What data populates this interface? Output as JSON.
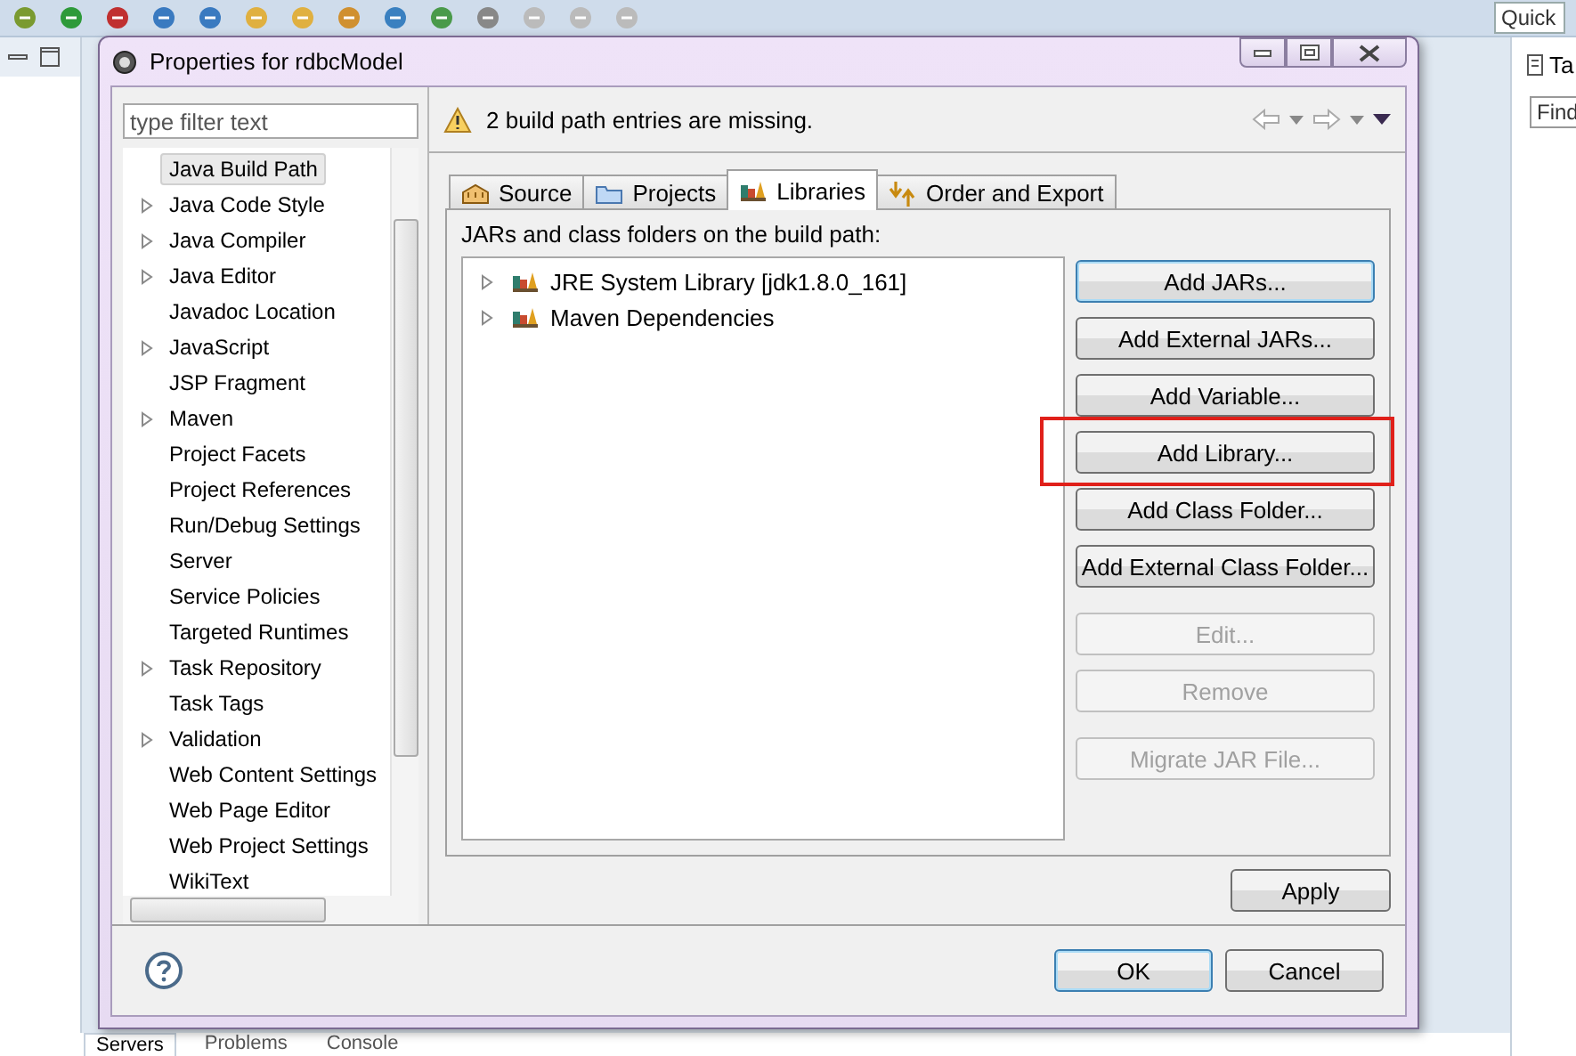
{
  "ide": {
    "quick_access": {
      "placeholder": "Quick"
    },
    "right_panel": {
      "tab": "Ta",
      "find": {
        "placeholder": "Find"
      }
    },
    "bottom_tabs": [
      {
        "label": "Servers",
        "selected": true
      },
      {
        "label": "Problems",
        "selected": false
      },
      {
        "label": "Console",
        "selected": false
      }
    ]
  },
  "window": {
    "title": "Properties for rdbcModel"
  },
  "filter": {
    "placeholder": "type filter text"
  },
  "nav": [
    {
      "label": "Java Build Path",
      "expandable": false,
      "selected": true
    },
    {
      "label": "Java Code Style",
      "expandable": true,
      "selected": false
    },
    {
      "label": "Java Compiler",
      "expandable": true,
      "selected": false
    },
    {
      "label": "Java Editor",
      "expandable": true,
      "selected": false
    },
    {
      "label": "Javadoc Location",
      "expandable": false,
      "selected": false
    },
    {
      "label": "JavaScript",
      "expandable": true,
      "selected": false
    },
    {
      "label": "JSP Fragment",
      "expandable": false,
      "selected": false
    },
    {
      "label": "Maven",
      "expandable": true,
      "selected": false
    },
    {
      "label": "Project Facets",
      "expandable": false,
      "selected": false
    },
    {
      "label": "Project References",
      "expandable": false,
      "selected": false
    },
    {
      "label": "Run/Debug Settings",
      "expandable": false,
      "selected": false
    },
    {
      "label": "Server",
      "expandable": false,
      "selected": false
    },
    {
      "label": "Service Policies",
      "expandable": false,
      "selected": false
    },
    {
      "label": "Targeted Runtimes",
      "expandable": false,
      "selected": false
    },
    {
      "label": "Task Repository",
      "expandable": true,
      "selected": false
    },
    {
      "label": "Task Tags",
      "expandable": false,
      "selected": false
    },
    {
      "label": "Validation",
      "expandable": true,
      "selected": false
    },
    {
      "label": "Web Content Settings",
      "expandable": false,
      "selected": false
    },
    {
      "label": "Web Page Editor",
      "expandable": false,
      "selected": false
    },
    {
      "label": "Web Project Settings",
      "expandable": false,
      "selected": false
    },
    {
      "label": "WikiText",
      "expandable": false,
      "selected": false
    }
  ],
  "message": "2 build path entries are missing.",
  "tabs": [
    {
      "label": "Source",
      "selected": false
    },
    {
      "label": "Projects",
      "selected": false
    },
    {
      "label": "Libraries",
      "selected": true
    },
    {
      "label": "Order and Export",
      "selected": false
    }
  ],
  "libraries": {
    "caption": "JARs and class folders on the build path:",
    "entries": [
      {
        "label": "JRE System Library [jdk1.8.0_161]",
        "expanded": false
      },
      {
        "label": "Maven Dependencies",
        "expanded": false
      }
    ],
    "button_groups": [
      [
        {
          "label": "Add JARs...",
          "disabled": false,
          "focused": true,
          "highlighted": false
        },
        {
          "label": "Add External JARs...",
          "disabled": false,
          "focused": false,
          "highlighted": false
        },
        {
          "label": "Add Variable...",
          "disabled": false,
          "focused": false,
          "highlighted": false
        },
        {
          "label": "Add Library...",
          "disabled": false,
          "focused": false,
          "highlighted": true
        },
        {
          "label": "Add Class Folder...",
          "disabled": false,
          "focused": false,
          "highlighted": false
        },
        {
          "label": "Add External Class Folder...",
          "disabled": false,
          "focused": false,
          "highlighted": false
        }
      ],
      [
        {
          "label": "Edit...",
          "disabled": true,
          "focused": false,
          "highlighted": false
        },
        {
          "label": "Remove",
          "disabled": true,
          "focused": false,
          "highlighted": false
        }
      ],
      [
        {
          "label": "Migrate JAR File...",
          "disabled": true,
          "focused": false,
          "highlighted": false
        }
      ]
    ]
  },
  "apply": {
    "label": "Apply"
  },
  "footer_buttons": [
    {
      "label": "OK",
      "focused": true
    },
    {
      "label": "Cancel",
      "focused": false
    }
  ]
}
